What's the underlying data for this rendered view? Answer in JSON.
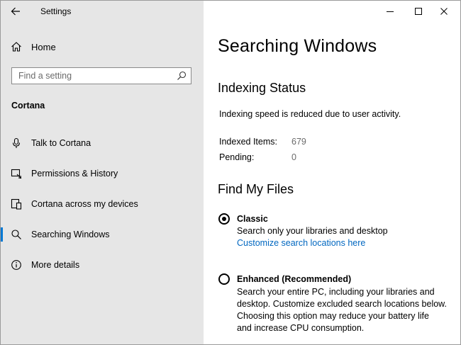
{
  "window": {
    "app_title": "Settings",
    "controls": [
      "minimize-icon",
      "maximize-icon",
      "close-icon"
    ]
  },
  "sidebar": {
    "home_label": "Home",
    "search": {
      "placeholder": "Find a setting",
      "value": ""
    },
    "section_label": "Cortana",
    "items": [
      {
        "label": "Talk to Cortana",
        "icon": "microphone-icon",
        "active": false
      },
      {
        "label": "Permissions & History",
        "icon": "permissions-icon",
        "active": false
      },
      {
        "label": "Cortana across my devices",
        "icon": "devices-icon",
        "active": false
      },
      {
        "label": "Searching Windows",
        "icon": "search-icon",
        "active": true
      },
      {
        "label": "More details",
        "icon": "info-icon",
        "active": false
      }
    ]
  },
  "main": {
    "title": "Searching Windows",
    "indexing": {
      "heading": "Indexing Status",
      "status_text": "Indexing speed is reduced due to user activity.",
      "indexed_items_label": "Indexed Items:",
      "indexed_items_value": "679",
      "pending_label": "Pending:",
      "pending_value": "0"
    },
    "find_files": {
      "heading": "Find My Files",
      "options": [
        {
          "label": "Classic",
          "checked": true,
          "description": "Search only your libraries and desktop",
          "link": "Customize search locations here"
        },
        {
          "label": "Enhanced (Recommended)",
          "checked": false,
          "description_lines": [
            "Search your entire PC, including your libraries and",
            "desktop. Customize excluded search locations below.",
            "Choosing this option may reduce your battery life",
            "and increase CPU consumption."
          ]
        }
      ]
    }
  },
  "colors": {
    "sidebar_bg": "#e6e6e6",
    "accent": "#0078d4",
    "link": "#0067c0",
    "muted_text": "#6b6b6b"
  }
}
